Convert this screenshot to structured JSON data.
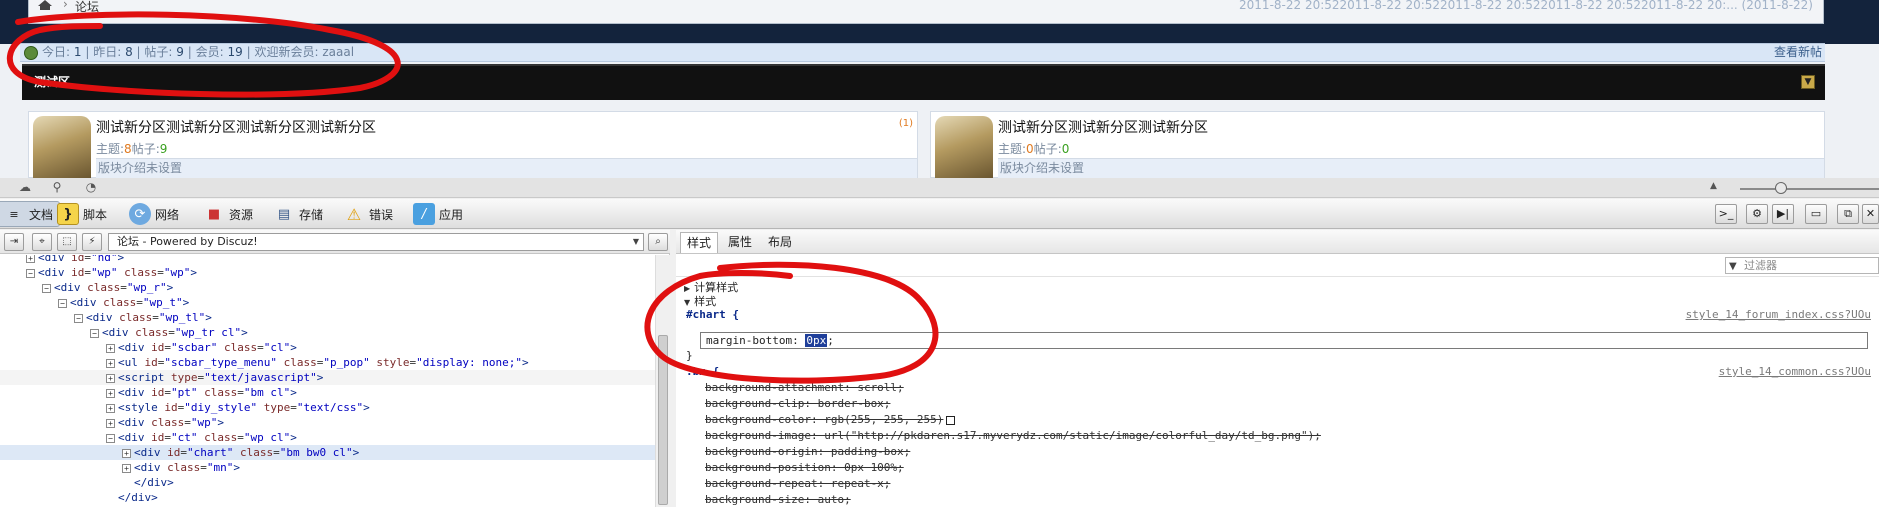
{
  "forum": {
    "breadcrumb": "论坛",
    "dates": "2011-8-22 20:522011-8-22 20:522011-8-22 20:522011-8-22 20:522011-8-22 20:...  (2011-8-22)",
    "stats": {
      "today_label": "今日:",
      "today_value": "1",
      "yesterday_label": "昨日:",
      "yesterday_value": "8",
      "posts_label": "帖子:",
      "posts_value": "9",
      "members_label": "会员:",
      "members_value": "19",
      "welcome_label": "欢迎新会员:",
      "welcome_user": "zaaal",
      "view_new_link": "查看新帖"
    },
    "category_title": "测试区",
    "boards": [
      {
        "name": "测试新分区测试新分区测试新分区测试新分区",
        "topics_label": "主题:",
        "topics_value": "8",
        "posts_label": "帖子:",
        "posts_value": "9",
        "desc": "版块介绍未设置",
        "count": "(1)"
      },
      {
        "name": "测试新分区测试新分区测试新分区",
        "topics_label": "主题:",
        "topics_value": "0",
        "posts_label": "帖子:",
        "posts_value": "0",
        "desc": "版块介绍未设置",
        "count": ""
      }
    ]
  },
  "devtools": {
    "tabs": [
      {
        "label": "文档",
        "icon": "document-icon"
      },
      {
        "label": "脚本",
        "icon": "script-icon"
      },
      {
        "label": "网络",
        "icon": "network-icon"
      },
      {
        "label": "资源",
        "icon": "resources-icon"
      },
      {
        "label": "存储",
        "icon": "storage-icon"
      },
      {
        "label": "错误",
        "icon": "error-icon"
      },
      {
        "label": "应用",
        "icon": "apps-icon"
      }
    ],
    "page_selector": "论坛 - Powered by Discuz!",
    "style_tabs": [
      "样式",
      "属性",
      "布局"
    ],
    "filter_placeholder": "过滤器",
    "computed_label": "计算样式",
    "styles_label": "样式",
    "rule1": {
      "selector": "#chart",
      "open": "{",
      "close": "}",
      "source": "style_14_forum_index.css?UOu",
      "prop": "margin-bottom:",
      "value": "0px",
      "semicolon": ";"
    },
    "rule2": {
      "selector": ".bm",
      "open": "{",
      "source": "style_14_common.css?UOu",
      "decls": [
        "background-attachment: scroll;",
        "background-clip: border-box;",
        "background-color: rgb(255, 255, 255)",
        "background-image: url(\"http://pkdaren.s17.myverydz.com/static/image/colorful_day/td_bg.png\");",
        "background-origin: padding-box;",
        "background-position: 0px 100%;",
        "background-repeat: repeat-x;",
        "background-size: auto;"
      ]
    },
    "tree": [
      {
        "indent": 1,
        "exp": "+",
        "tag": "div",
        "attrs": [
          [
            "id",
            "\"hd\""
          ]
        ],
        "close": ">"
      },
      {
        "indent": 1,
        "exp": "−",
        "tag": "div",
        "attrs": [
          [
            "id",
            "\"wp\""
          ],
          [
            "class",
            "\"wp\""
          ]
        ],
        "close": ">"
      },
      {
        "indent": 2,
        "exp": "−",
        "tag": "div",
        "attrs": [
          [
            "class",
            "\"wp_r\""
          ]
        ],
        "close": ">"
      },
      {
        "indent": 3,
        "exp": "−",
        "tag": "div",
        "attrs": [
          [
            "class",
            "\"wp_t\""
          ]
        ],
        "close": ">"
      },
      {
        "indent": 4,
        "exp": "−",
        "tag": "div",
        "attrs": [
          [
            "class",
            "\"wp_tl\""
          ]
        ],
        "close": ">"
      },
      {
        "indent": 5,
        "exp": "−",
        "tag": "div",
        "attrs": [
          [
            "class",
            "\"wp_tr cl\""
          ]
        ],
        "close": ">"
      },
      {
        "indent": 6,
        "exp": "+",
        "tag": "div",
        "attrs": [
          [
            "id",
            "\"scbar\""
          ],
          [
            "class",
            "\"cl\""
          ]
        ],
        "close": ">"
      },
      {
        "indent": 6,
        "exp": "+",
        "tag": "ul",
        "attrs": [
          [
            "id",
            "\"scbar_type_menu\""
          ],
          [
            "class",
            "\"p_pop\""
          ],
          [
            "style",
            "\"display: none;\""
          ]
        ],
        "close": ">"
      },
      {
        "indent": 6,
        "exp": "+",
        "tag": "script",
        "attrs": [
          [
            "type",
            "\"text/javascript\""
          ]
        ],
        "close": ">",
        "faded": true
      },
      {
        "indent": 6,
        "exp": "+",
        "tag": "div",
        "attrs": [
          [
            "id",
            "\"pt\""
          ],
          [
            "class",
            "\"bm cl\""
          ]
        ],
        "close": ">"
      },
      {
        "indent": 6,
        "exp": "+",
        "tag": "style",
        "attrs": [
          [
            "id",
            "\"diy_style\""
          ],
          [
            "type",
            "\"text/css\""
          ]
        ],
        "close": ">"
      },
      {
        "indent": 6,
        "exp": "+",
        "tag": "div",
        "attrs": [
          [
            "class",
            "\"wp\""
          ]
        ],
        "close": ">"
      },
      {
        "indent": 6,
        "exp": "−",
        "tag": "div",
        "attrs": [
          [
            "id",
            "\"ct\""
          ],
          [
            "class",
            "\"wp cl\""
          ]
        ],
        "close": ">"
      },
      {
        "indent": 7,
        "exp": "+",
        "tag": "div",
        "attrs": [
          [
            "id",
            "\"chart\""
          ],
          [
            "class",
            "\"bm bw0 cl\""
          ]
        ],
        "close": ">",
        "selected": true
      },
      {
        "indent": 7,
        "exp": "+",
        "tag": "div",
        "attrs": [
          [
            "class",
            "\"mn\""
          ]
        ],
        "close": ">"
      },
      {
        "indent": 7,
        "exp": "",
        "tag": "/div",
        "attrs": [],
        "close": ">"
      },
      {
        "indent": 6,
        "exp": "",
        "tag": "/div",
        "attrs": [],
        "close": ">"
      }
    ]
  }
}
